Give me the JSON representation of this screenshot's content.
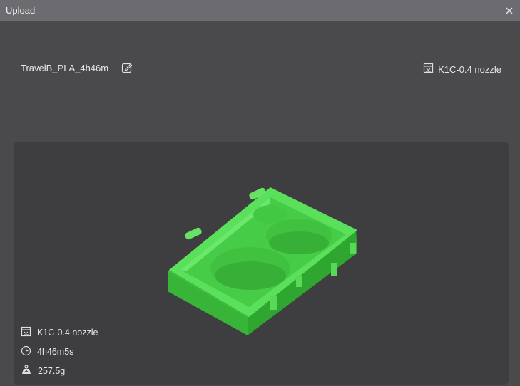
{
  "window": {
    "title": "Upload"
  },
  "header": {
    "file_name": "TravelB_PLA_4h46m",
    "printer": "K1C-0.4 nozzle"
  },
  "preview": {
    "printer": "K1C-0.4 nozzle",
    "print_time": "4h46m5s",
    "weight": "257.5g",
    "model_color": "#4fd84f"
  }
}
